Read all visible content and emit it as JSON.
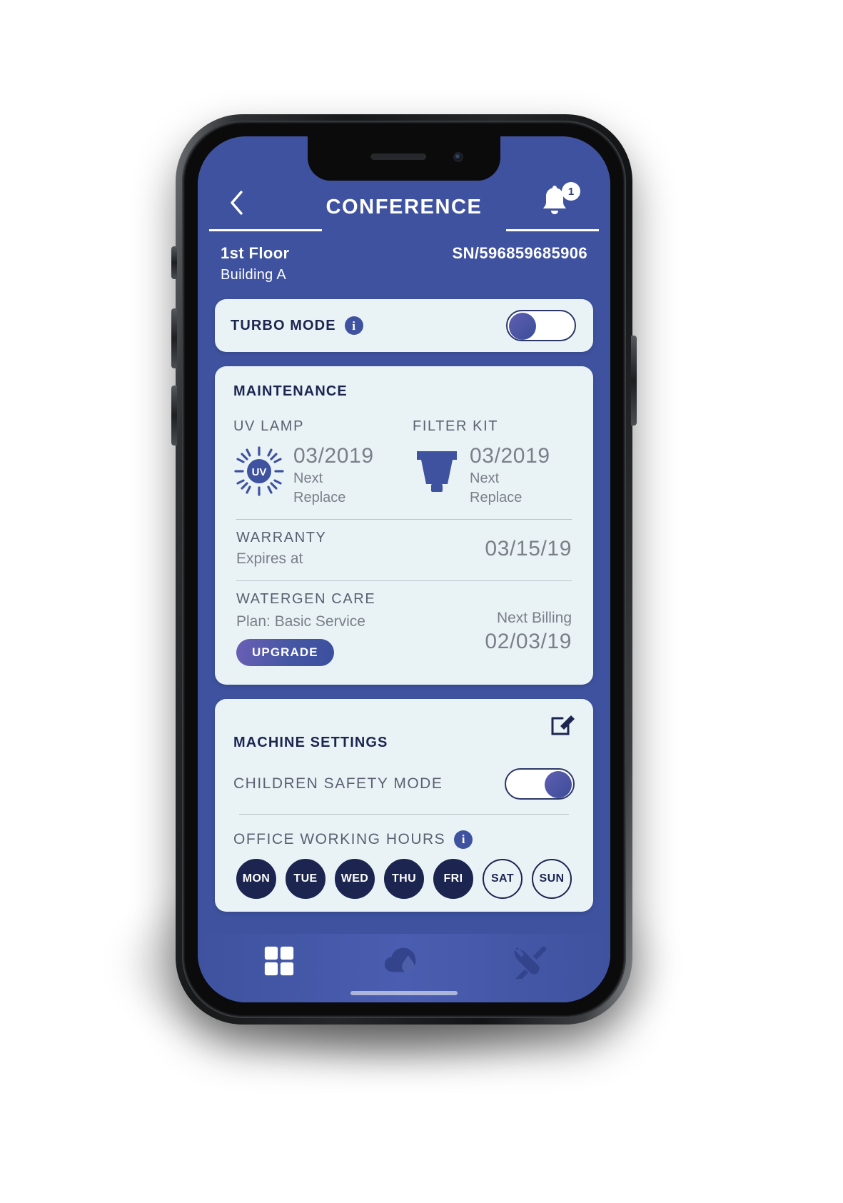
{
  "header": {
    "back_icon": "chevron-left-icon",
    "title": "CONFERENCE",
    "bell_icon": "notification-bell-icon",
    "badge_count": "1"
  },
  "location": {
    "floor": "1st Floor",
    "building": "Building A",
    "serial": "SN/596859685906"
  },
  "turbo": {
    "label": "TURBO MODE",
    "info_icon": "info-icon",
    "info_glyph": "i",
    "state": "off"
  },
  "maintenance": {
    "title": "MAINTENANCE",
    "items": [
      {
        "label": "UV LAMP",
        "icon": "uv-lamp-icon",
        "icon_text": "UV",
        "date": "03/2019",
        "sub_line1": "Next",
        "sub_line2": "Replace"
      },
      {
        "label": "FILTER KIT",
        "icon": "filter-kit-icon",
        "date": "03/2019",
        "sub_line1": "Next",
        "sub_line2": "Replace"
      }
    ],
    "warranty": {
      "title": "WARRANTY",
      "sub": "Expires at",
      "date": "03/15/19"
    },
    "care": {
      "title": "WATERGEN CARE",
      "plan": "Plan: Basic Service",
      "billing_label": "Next Billing",
      "billing_date": "02/03/19",
      "upgrade_label": "UPGRADE"
    }
  },
  "machine_settings": {
    "title": "MACHINE SETTINGS",
    "edit_icon": "edit-pencil-icon",
    "children_safety": {
      "label": "CHILDREN SAFETY MODE",
      "state": "on"
    },
    "office_hours": {
      "label": "OFFICE WORKING HOURS",
      "info_glyph": "i",
      "days": [
        {
          "label": "MON",
          "selected": true
        },
        {
          "label": "TUE",
          "selected": true
        },
        {
          "label": "WED",
          "selected": true
        },
        {
          "label": "THU",
          "selected": true
        },
        {
          "label": "FRI",
          "selected": true
        },
        {
          "label": "SAT",
          "selected": false
        },
        {
          "label": "SUN",
          "selected": false
        }
      ]
    }
  },
  "bottom_nav": [
    {
      "name": "dashboard-grid-icon",
      "active": true
    },
    {
      "name": "water-drop-cloud-icon",
      "active": false
    },
    {
      "name": "tools-wrench-icon",
      "active": false
    }
  ],
  "colors": {
    "brand_blue": "#3f529f",
    "deep_navy": "#1b2550",
    "card_bg": "#e9f3f6",
    "muted_text": "#7b7f88"
  }
}
